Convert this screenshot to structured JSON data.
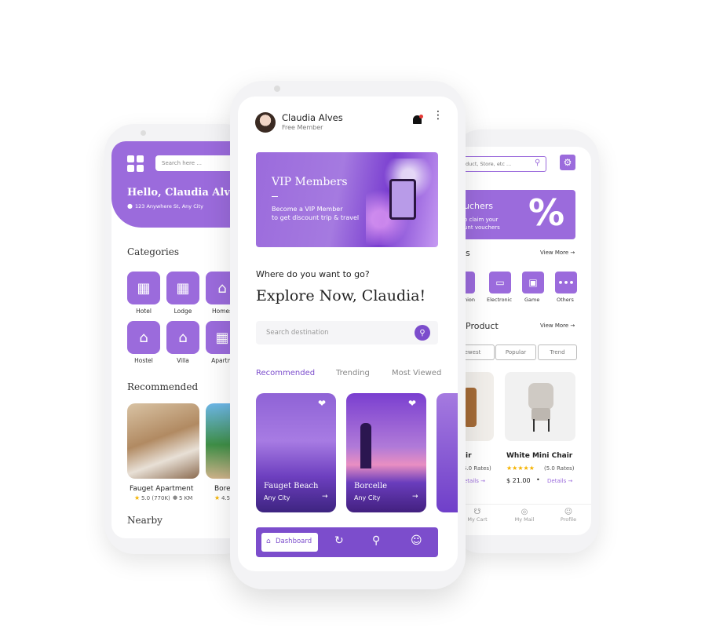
{
  "left": {
    "search_placeholder": "Search here ...",
    "greeting": "Hello, Claudia Alves!",
    "address": "123 Anywhere St, Any City",
    "categories_title": "Categories",
    "categories": [
      "Hotel",
      "Lodge",
      "Homestay",
      "Hostel",
      "Villa",
      "Apartment"
    ],
    "categories_visible": [
      "Hotel",
      "Lodge",
      "Homes",
      "Hostel",
      "Villa",
      "Apartm"
    ],
    "recommended_title": "Recommended",
    "rec1_name": "Fauget Apartment",
    "rec1_rating": "5.0 (770K)",
    "rec1_distance": "5 KM",
    "rec2_name": "Bore",
    "rec2_rating": "4.5",
    "nearby_title": "Nearby"
  },
  "center": {
    "user_name": "Claudia Alves",
    "user_status": "Free Member",
    "banner_title": "VIP Members",
    "banner_line1": "Become a VIP Member",
    "banner_line2": "to get discount trip & travel",
    "question": "Where do you want to go?",
    "headline": "Explore Now, Claudia!",
    "search_placeholder": "Search destination",
    "tabs": [
      "Recommended",
      "Trending",
      "Most Viewed"
    ],
    "card1_title": "Fauget Beach",
    "card1_sub": "Any City",
    "card2_title": "Borcelle",
    "card2_sub": "Any City",
    "nav_dashboard": "Dashboard",
    "colors": {
      "accent": "#9b6bdc",
      "accent_dark": "#7c4dcc"
    }
  },
  "right": {
    "search_placeholder": "duct, Store, etc ...",
    "voucher_title": "uchers",
    "voucher_line1": "o claim your",
    "voucher_line2": "unt vouchers",
    "voucher_symbol": "%",
    "section1_title": "s",
    "view_more": "View More",
    "cat_labels": [
      "hion",
      "Electronic",
      "Game",
      "Others"
    ],
    "product_title": "Product",
    "filters": [
      "ewest",
      "Popular",
      "Trend"
    ],
    "p1_name": "ir",
    "p1_rates": "5.0 Rates)",
    "p1_details": "etails",
    "p2_name": "White Mini Chair",
    "p2_rates": "(5.0 Rates)",
    "p2_price": "$ 21.00",
    "p2_details": "Details",
    "nav": [
      "My Cart",
      "My Mail",
      "Profile"
    ]
  }
}
